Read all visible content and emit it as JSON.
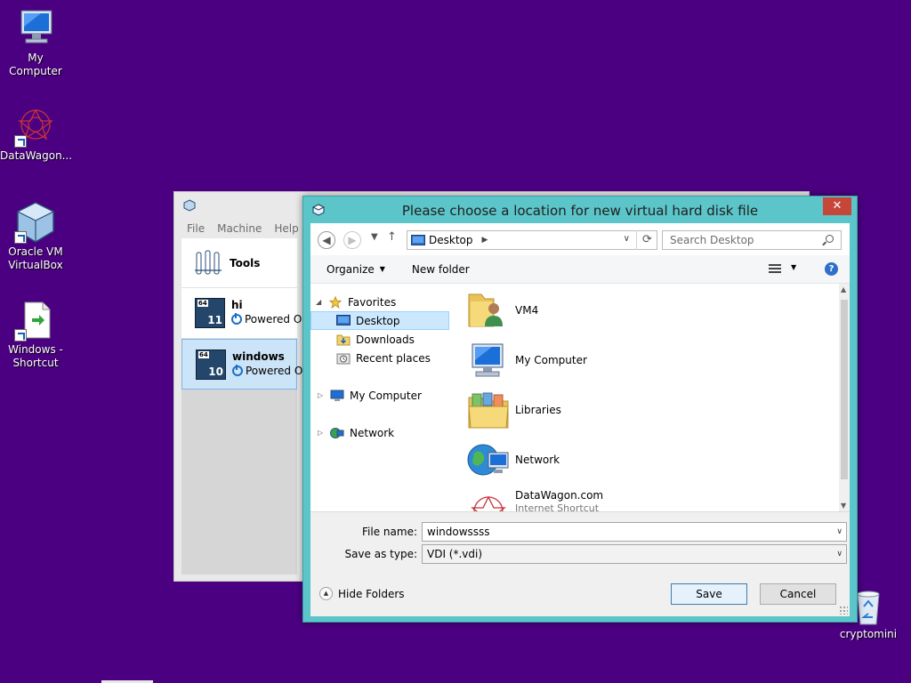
{
  "desktop": {
    "icons": [
      {
        "label": "My Computer",
        "icon": "computer-icon"
      },
      {
        "label": "DataWagon...",
        "icon": "datawagon-icon"
      },
      {
        "label": "Oracle VM VirtualBox",
        "icon": "virtualbox-icon"
      },
      {
        "label": "Windows - Shortcut",
        "icon": "shortcut-file-icon"
      },
      {
        "label": "cryptomini",
        "icon": "recycle-bin-icon"
      }
    ]
  },
  "vbox": {
    "menu": [
      "File",
      "Machine",
      "Help"
    ],
    "tools_label": "Tools",
    "vms": [
      {
        "name": "hi",
        "state": "Powered O",
        "os_badge": "11",
        "selected": false
      },
      {
        "name": "windows",
        "state": "Powered O",
        "os_badge": "10",
        "selected": true
      }
    ],
    "os_bits": "64"
  },
  "dialog": {
    "title": "Please choose a location for new virtual hard disk file",
    "close_label": "✕",
    "address": "Desktop",
    "search_placeholder": "Search Desktop",
    "toolbar": {
      "organize": "Organize",
      "new_folder": "New folder"
    },
    "nav": {
      "favorites": "Favorites",
      "desktop": "Desktop",
      "downloads": "Downloads",
      "recent": "Recent places",
      "my_computer": "My Computer",
      "network": "Network"
    },
    "items": [
      {
        "name": "VM4",
        "sub": "",
        "icon": "user-folder-icon"
      },
      {
        "name": "My Computer",
        "sub": "",
        "icon": "computer-icon"
      },
      {
        "name": "Libraries",
        "sub": "",
        "icon": "libraries-icon"
      },
      {
        "name": "Network",
        "sub": "",
        "icon": "network-icon"
      },
      {
        "name": "DataWagon.com",
        "sub": "Internet Shortcut",
        "icon": "datawagon-icon"
      }
    ],
    "file_name_label": "File name:",
    "file_name_value": "windowssss",
    "save_type_label": "Save as type:",
    "save_type_value": "VDI (*.vdi)",
    "hide_folders": "Hide Folders",
    "save_label": "Save",
    "cancel_label": "Cancel"
  },
  "colors": {
    "desktop_bg": "#4b0082",
    "dialog_frame": "#5bc5ca",
    "close_red": "#c7463a",
    "selection": "#cce8ff"
  }
}
